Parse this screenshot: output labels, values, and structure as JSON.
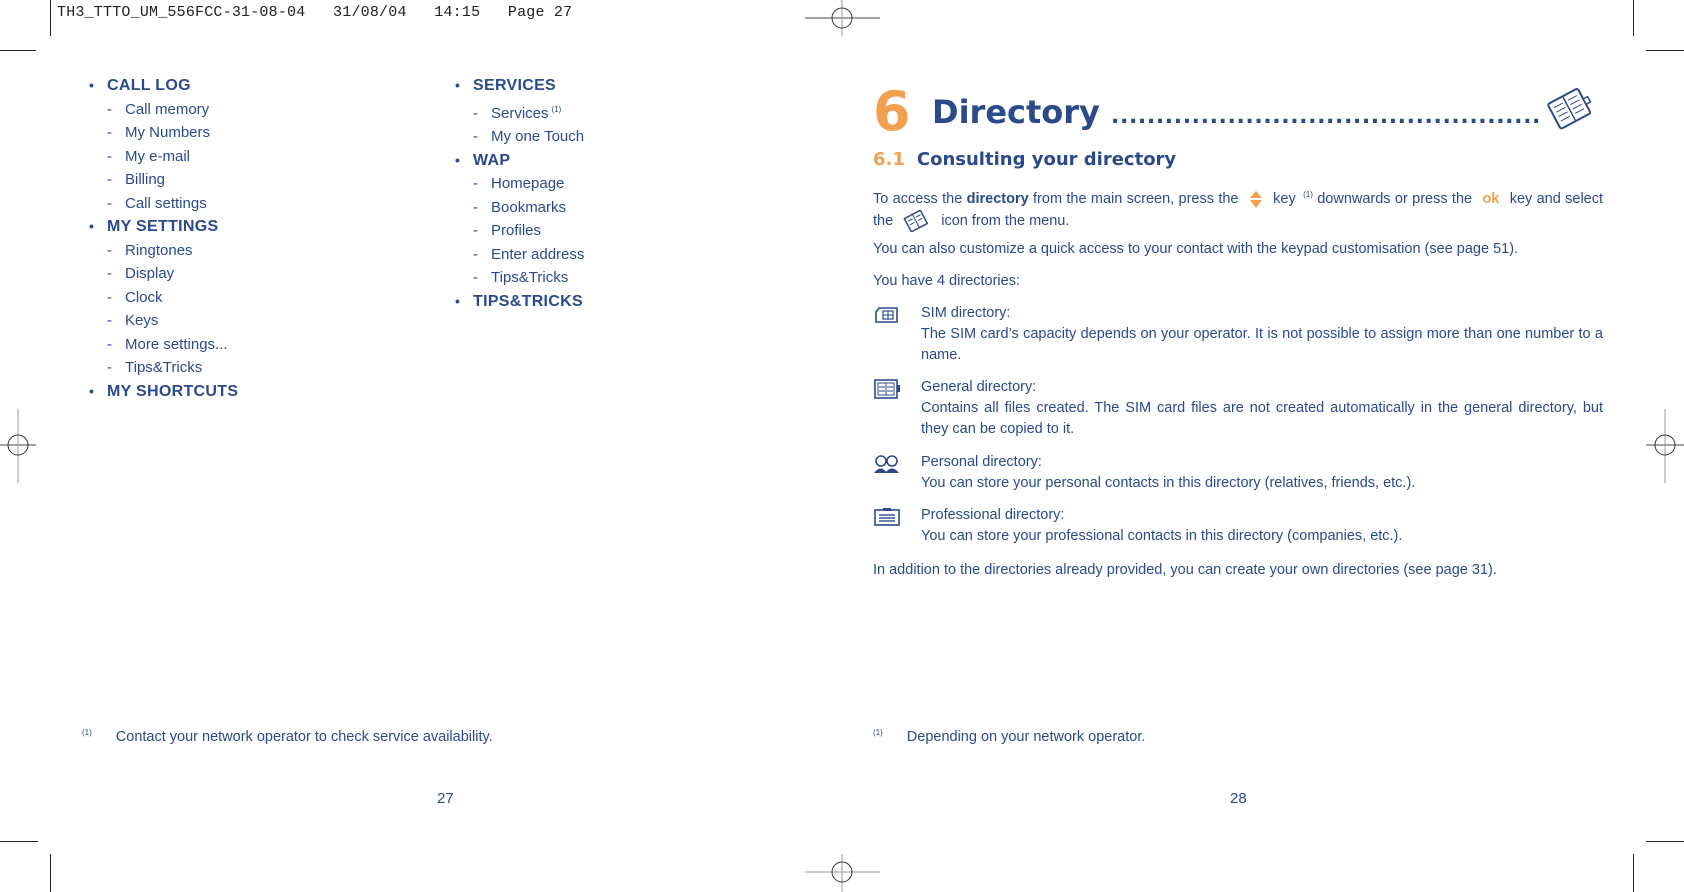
{
  "slug": "TH3_TTTO_UM_556FCC-31-08-04   31/08/04   14:15   Page 27",
  "left_page": {
    "column1": [
      {
        "category": "CALL LOG",
        "items": [
          "Call memory",
          "My Numbers",
          "My e-mail",
          "Billing",
          "Call settings"
        ]
      },
      {
        "category": "MY SETTINGS",
        "items": [
          "Ringtones",
          "Display",
          "Clock",
          "Keys",
          "More settings...",
          "Tips&Tricks"
        ]
      },
      {
        "category": "MY SHORTCUTS",
        "items": []
      }
    ],
    "column2": [
      {
        "category": "SERVICES",
        "items": [
          "Services",
          "My one Touch"
        ],
        "footnote_marker_on_item": "(1)"
      },
      {
        "category": "WAP",
        "items": [
          "Homepage",
          "Bookmarks",
          "Profiles",
          "Enter address",
          "Tips&Tricks"
        ]
      },
      {
        "category": "TIPS&TRICKS",
        "items": []
      }
    ],
    "footnote_marker": "(1)",
    "footnote": "Contact your network operator to check service availability.",
    "page_number": "27"
  },
  "right_page": {
    "chapter_number": "6",
    "chapter_title": "Directory",
    "chapter_dots": "................................................",
    "section_number": "6.1",
    "section_title": "Consulting your directory",
    "intro": {
      "p1a": "To access the ",
      "p1b": "directory",
      "p1c": " from the main screen, press the",
      "p1d": "key",
      "p1sup": "(1)",
      "p1e": "downwards or press the",
      "ok_key": "ok",
      "p1f": "key and select the",
      "p1g": "icon from the menu."
    },
    "p2": "You can also customize a quick access to your contact with the keypad customisation (see page 51).",
    "p3": "You have 4 directories:",
    "directories": [
      {
        "icon": "sim-card-icon",
        "title": "SIM directory:",
        "desc": "The SIM card’s capacity depends on your operator. It is not possible to assign more than one number to a name."
      },
      {
        "icon": "general-directory-icon",
        "title": "General directory:",
        "desc": "Contains all files created. The SIM card files are not created automatically in the general directory, but they can be copied to it."
      },
      {
        "icon": "personal-contacts-icon",
        "title": "Personal directory:",
        "desc": "You can store your personal contacts in this directory (relatives, friends, etc.)."
      },
      {
        "icon": "professional-directory-icon",
        "title": "Professional directory:",
        "desc": "You can store your professional contacts in this directory (companies, etc.)."
      }
    ],
    "p4": "In addition to the directories already provided, you can create your own directories (see page 31).",
    "footnote_marker": "(1)",
    "footnote": "Depending on your network operator.",
    "page_number": "28"
  },
  "colors": {
    "text_blue": "#2a4a8c",
    "accent_orange": "#f0a050"
  }
}
